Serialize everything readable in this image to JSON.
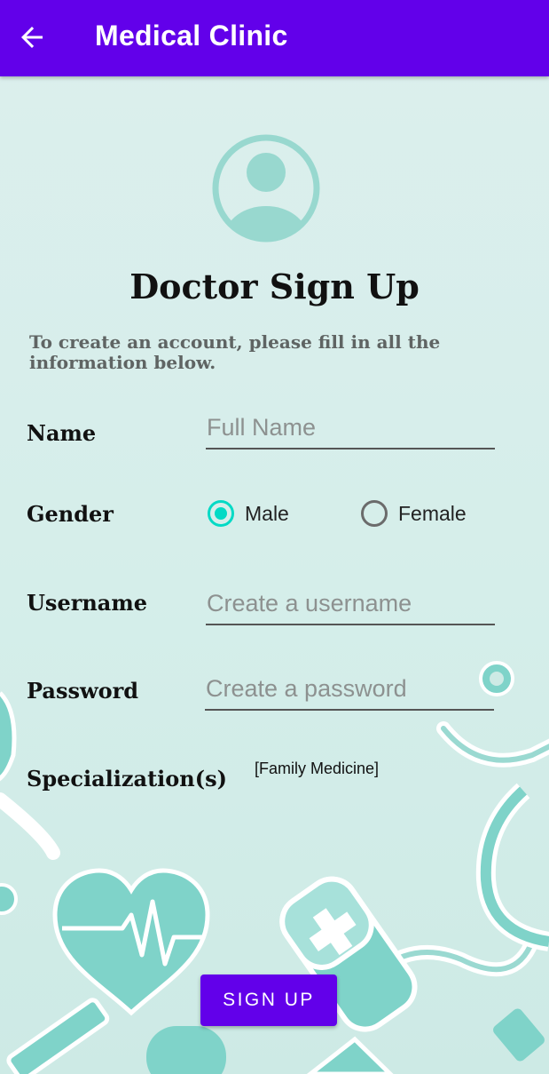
{
  "appbar": {
    "title": "Medical Clinic",
    "back_icon": "arrow-left-icon"
  },
  "page": {
    "title": "Doctor Sign Up",
    "instructions": "To create an account, please fill in all the information below."
  },
  "form": {
    "name": {
      "label": "Name",
      "placeholder": "Full Name",
      "value": ""
    },
    "gender": {
      "label": "Gender",
      "options": [
        {
          "label": "Male",
          "selected": true
        },
        {
          "label": "Female",
          "selected": false
        }
      ]
    },
    "username": {
      "label": "Username",
      "placeholder": "Create a username",
      "value": ""
    },
    "password": {
      "label": "Password",
      "placeholder": "Create a password",
      "value": ""
    },
    "specialization": {
      "label": "Specialization(s)",
      "value": "[Family Medicine]"
    }
  },
  "actions": {
    "signup_label": "SIGN UP"
  },
  "colors": {
    "primary": "#6200ea",
    "accent": "#03dac5",
    "background": "#dcefed",
    "illustration": "#7fd3c9"
  },
  "icons": {
    "avatar": "account-circle-icon"
  }
}
